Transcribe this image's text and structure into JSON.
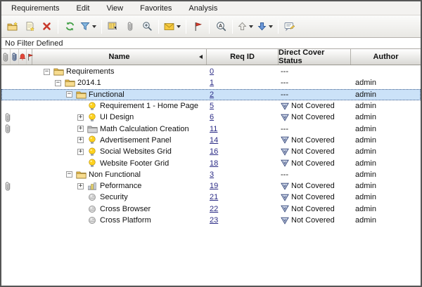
{
  "menu": {
    "items": [
      "Requirements",
      "Edit",
      "View",
      "Favorites",
      "Analysis"
    ]
  },
  "toolbar": {
    "groups": [
      [
        {
          "icon": "new-folder-icon"
        },
        {
          "icon": "new-requirement-icon"
        },
        {
          "icon": "delete-icon"
        }
      ],
      [
        {
          "icon": "refresh-icon"
        },
        {
          "icon": "filter-icon",
          "caret": true
        }
      ],
      [
        {
          "icon": "select-columns-icon"
        },
        {
          "icon": "attachment-icon"
        },
        {
          "icon": "zoom-icon"
        }
      ],
      [
        {
          "icon": "email-icon",
          "caret": true
        }
      ],
      [
        {
          "icon": "flag-icon"
        }
      ],
      [
        {
          "icon": "find-icon"
        }
      ],
      [
        {
          "icon": "go-up-icon",
          "caret": true
        },
        {
          "icon": "go-down-icon",
          "caret": true
        }
      ],
      [
        {
          "icon": "comments-icon"
        }
      ]
    ]
  },
  "filter_bar": {
    "text": "No Filter Defined"
  },
  "grid": {
    "gutter_icons": [
      "attachment-icon",
      "rich-text-icon",
      "alert-icon",
      "followup-flag-icon"
    ],
    "columns": [
      {
        "label": "Name",
        "sort": "left"
      },
      {
        "label": "Req ID"
      },
      {
        "label": "Direct Cover Status"
      },
      {
        "label": "Author"
      }
    ],
    "status_not_covered": "Not Covered",
    "status_none": "---",
    "rows": [
      {
        "name": "Requirements",
        "level": 0,
        "expander": "minus",
        "icon": "folder-icon",
        "req_id": "0",
        "status": "---",
        "author": "",
        "attachment": false,
        "selected": false
      },
      {
        "name": "2014.1",
        "level": 1,
        "expander": "minus",
        "icon": "folder-icon",
        "req_id": "1",
        "status": "---",
        "author": "admin",
        "attachment": false,
        "selected": false
      },
      {
        "name": "Functional",
        "level": 2,
        "expander": "minus",
        "icon": "folder-icon",
        "req_id": "2",
        "status": "---",
        "author": "admin",
        "attachment": false,
        "selected": true
      },
      {
        "name": "Requirement 1 - Home Page",
        "level": 3,
        "expander": "none",
        "icon": "bulb-icon",
        "req_id": "5",
        "status": "Not Covered",
        "author": "admin",
        "attachment": false,
        "selected": false
      },
      {
        "name": "UI Design",
        "level": 3,
        "expander": "plus",
        "icon": "bulb-icon",
        "req_id": "6",
        "status": "Not Covered",
        "author": "admin",
        "attachment": true,
        "selected": false
      },
      {
        "name": "Math Calculation Creation",
        "level": 3,
        "expander": "plus",
        "icon": "gray-folder-icon",
        "req_id": "11",
        "status": "---",
        "author": "admin",
        "attachment": true,
        "selected": false
      },
      {
        "name": "Advertisement Panel",
        "level": 3,
        "expander": "plus",
        "icon": "bulb-icon",
        "req_id": "14",
        "status": "Not Covered",
        "author": "admin",
        "attachment": false,
        "selected": false
      },
      {
        "name": "Social Websites Grid",
        "level": 3,
        "expander": "plus",
        "icon": "bulb-icon",
        "req_id": "16",
        "status": "Not Covered",
        "author": "admin",
        "attachment": false,
        "selected": false
      },
      {
        "name": "Website Footer Grid",
        "level": 3,
        "expander": "none",
        "icon": "bulb-icon",
        "req_id": "18",
        "status": "Not Covered",
        "author": "admin",
        "attachment": false,
        "selected": false
      },
      {
        "name": "Non Functional",
        "level": 2,
        "expander": "minus",
        "icon": "folder-icon",
        "req_id": "3",
        "status": "---",
        "author": "admin",
        "attachment": false,
        "selected": false
      },
      {
        "name": "Peformance",
        "level": 3,
        "expander": "plus",
        "icon": "performance-icon",
        "req_id": "19",
        "status": "Not Covered",
        "author": "admin",
        "attachment": true,
        "selected": false
      },
      {
        "name": "Security",
        "level": 3,
        "expander": "none",
        "icon": "sphere-icon",
        "req_id": "21",
        "status": "Not Covered",
        "author": "admin",
        "attachment": false,
        "selected": false
      },
      {
        "name": "Cross Browser",
        "level": 3,
        "expander": "none",
        "icon": "sphere-icon",
        "req_id": "22",
        "status": "Not Covered",
        "author": "admin",
        "attachment": false,
        "selected": false
      },
      {
        "name": "Cross Platform",
        "level": 3,
        "expander": "none",
        "icon": "sphere-icon",
        "req_id": "23",
        "status": "Not Covered",
        "author": "admin",
        "attachment": false,
        "selected": false
      }
    ]
  },
  "colors": {
    "selection_bg": "#cbe2f8",
    "link": "#2c2c86",
    "accent_red": "#d63a2a",
    "accent_green": "#43a047",
    "accent_blue": "#6b97d8",
    "folder_yellow": "#f7dc8f"
  }
}
